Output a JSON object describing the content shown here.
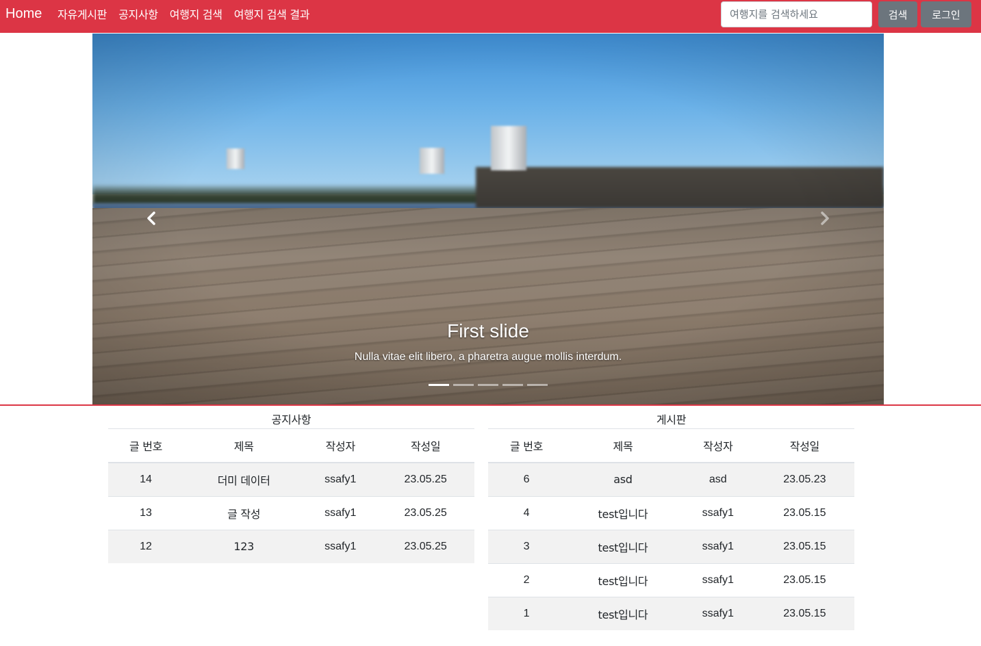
{
  "navbar": {
    "brand": "Home",
    "links": [
      "자유게시판",
      "공지사항",
      "여행지 검색",
      "여행지 검색 결과"
    ],
    "search_placeholder": "여행지를 검색하세요",
    "search_button": "검색",
    "login_button": "로그인",
    "color": "#dc3545"
  },
  "carousel": {
    "title": "First slide",
    "text": "Nulla vitae elit libero, a pharetra augue mollis interdum.",
    "slide_count": 5,
    "active_index": 0,
    "prev_icon": "chevron-left-icon",
    "next_icon": "chevron-right-icon"
  },
  "notice_table": {
    "caption": "공지사항",
    "headers": [
      "글 번호",
      "제목",
      "작성자",
      "작성일"
    ],
    "rows": [
      [
        "14",
        "더미 데이터",
        "ssafy1",
        "23.05.25"
      ],
      [
        "13",
        "글 작성",
        "ssafy1",
        "23.05.25"
      ],
      [
        "12",
        "123",
        "ssafy1",
        "23.05.25"
      ]
    ]
  },
  "board_table": {
    "caption": "게시판",
    "headers": [
      "글 번호",
      "제목",
      "작성자",
      "작성일"
    ],
    "rows": [
      [
        "6",
        "asd",
        "asd",
        "23.05.23"
      ],
      [
        "4",
        "test입니다",
        "ssafy1",
        "23.05.15"
      ],
      [
        "3",
        "test입니다",
        "ssafy1",
        "23.05.15"
      ],
      [
        "2",
        "test입니다",
        "ssafy1",
        "23.05.15"
      ],
      [
        "1",
        "test입니다",
        "ssafy1",
        "23.05.15"
      ]
    ]
  }
}
